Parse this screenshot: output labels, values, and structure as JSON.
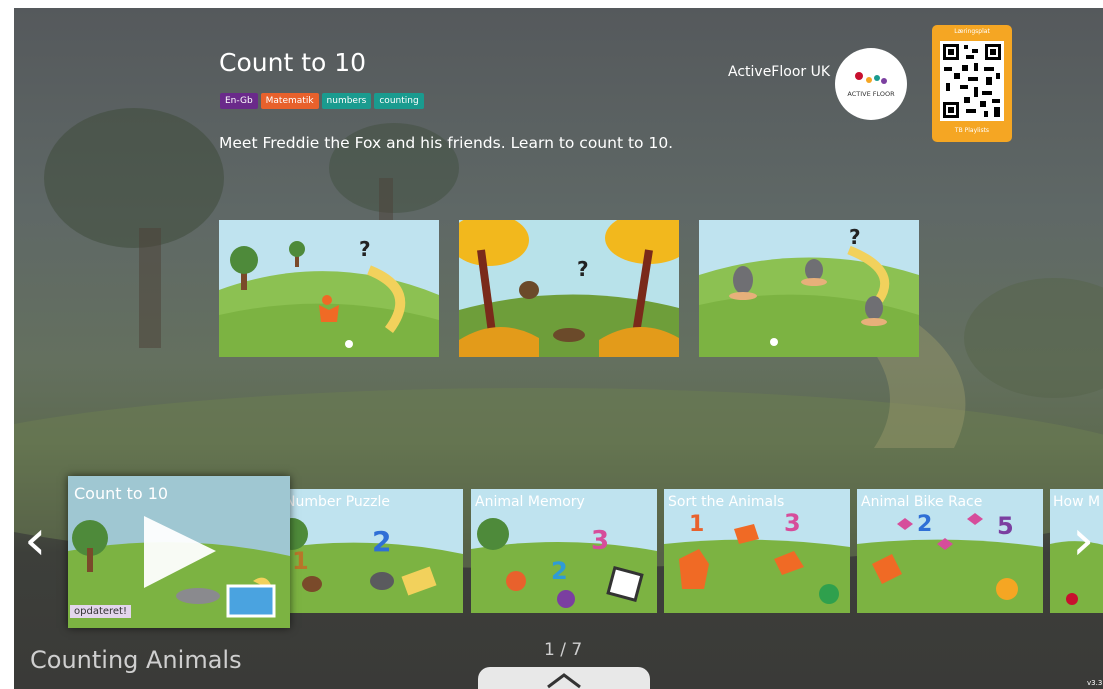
{
  "game": {
    "title": "Count to 10",
    "tags": [
      {
        "label": "En-Gb",
        "color": "#6a2a8a"
      },
      {
        "label": "Matematik",
        "color": "#e8612c"
      },
      {
        "label": "numbers",
        "color": "#1a9b8f"
      },
      {
        "label": "counting",
        "color": "#1a9b8f"
      }
    ],
    "description": "Meet Freddie the Fox and his friends. Learn to count to 10.",
    "publisher": "ActiveFloor UK",
    "logo_text": "ACTIVE FLOOR",
    "qr": {
      "top_label": "Læringsplat",
      "bottom_label": "TB Playlists"
    },
    "screenshots": [
      "fox-scene",
      "hedgehog-scene",
      "moles-scene"
    ]
  },
  "carousel": {
    "featured": {
      "title": "Count to 10",
      "badge": "opdateret!"
    },
    "items": [
      {
        "title": "Number Puzzle"
      },
      {
        "title": "Animal Memory"
      },
      {
        "title": "Sort the Animals"
      },
      {
        "title": "Animal Bike Race"
      },
      {
        "title": "How M"
      }
    ],
    "prev_icon": "‹",
    "next_icon": "›"
  },
  "section": {
    "title": "Counting Animals",
    "page": "1 / 7"
  },
  "version": "v3.3",
  "colors": {
    "accent": "#f5a623",
    "sky": "#bfe3ef",
    "grass": "#7cb342"
  }
}
